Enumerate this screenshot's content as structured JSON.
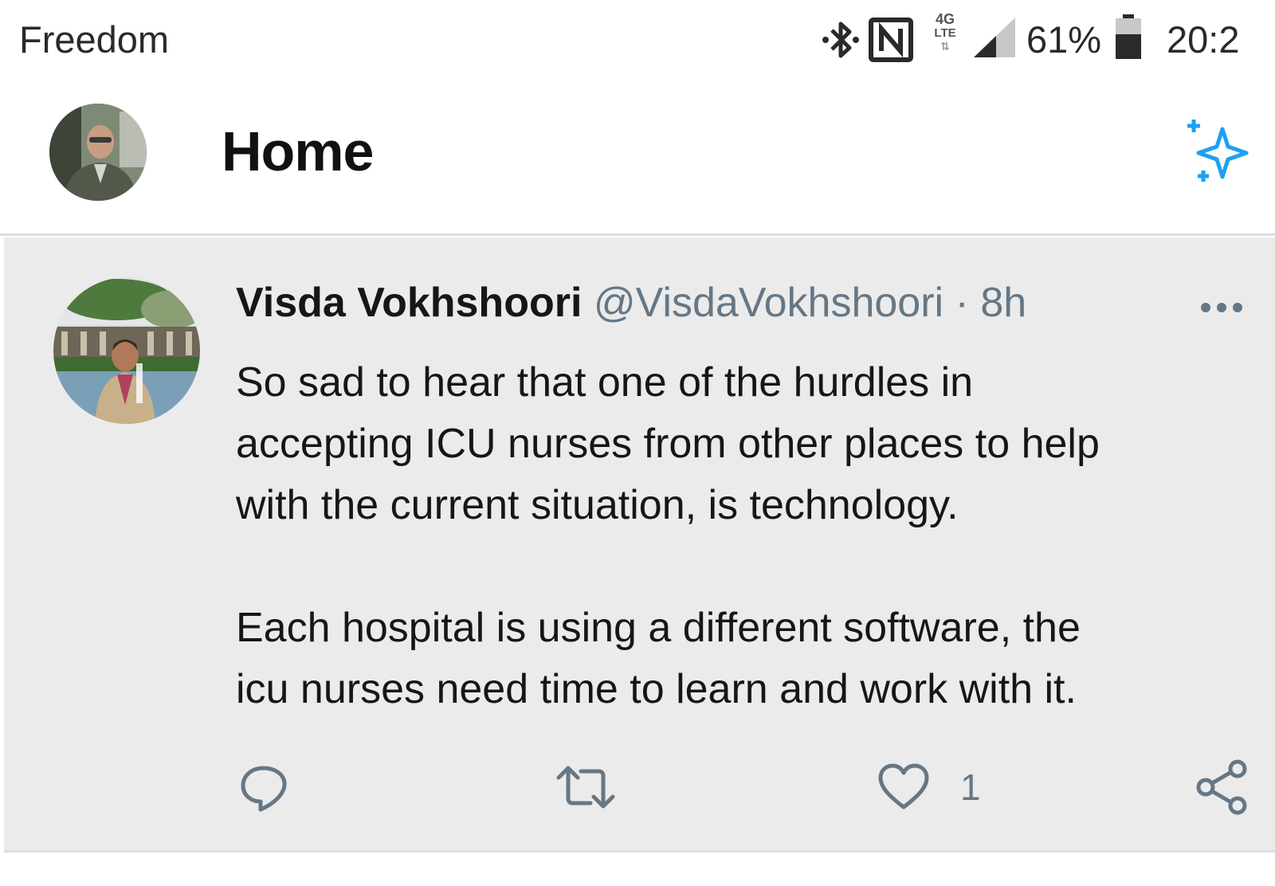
{
  "status_bar": {
    "carrier": "Freedom",
    "network_label_top": "4G",
    "network_label_bottom": "LTE",
    "battery_percent": "61%",
    "time": "20:2",
    "icons": [
      "bluetooth-icon",
      "nfc-icon",
      "lte-icon",
      "signal-icon",
      "battery-icon"
    ]
  },
  "header": {
    "title": "Home",
    "sparkle_icon": "sparkle-icon"
  },
  "tweet": {
    "author_name": "Visda Vokhshoori",
    "author_handle": "@VisdaVokhshoori",
    "separator": "·",
    "time": "8h",
    "paragraphs": [
      [
        "So sad to hear that one of the hurdles in",
        "accepting ICU nurses from other places to help",
        "with the current situation, is technology."
      ],
      [
        "Each hospital is using a different software, the",
        "icu nurses need time to learn and work with it."
      ]
    ],
    "actions": {
      "reply_icon": "reply-icon",
      "retweet_icon": "retweet-icon",
      "like_icon": "heart-icon",
      "like_count": "1",
      "share_icon": "share-icon"
    }
  },
  "colors": {
    "accent": "#1da1f2",
    "muted": "#657786",
    "tweet_bg": "#ebebeb",
    "divider": "#d9dfe3"
  }
}
